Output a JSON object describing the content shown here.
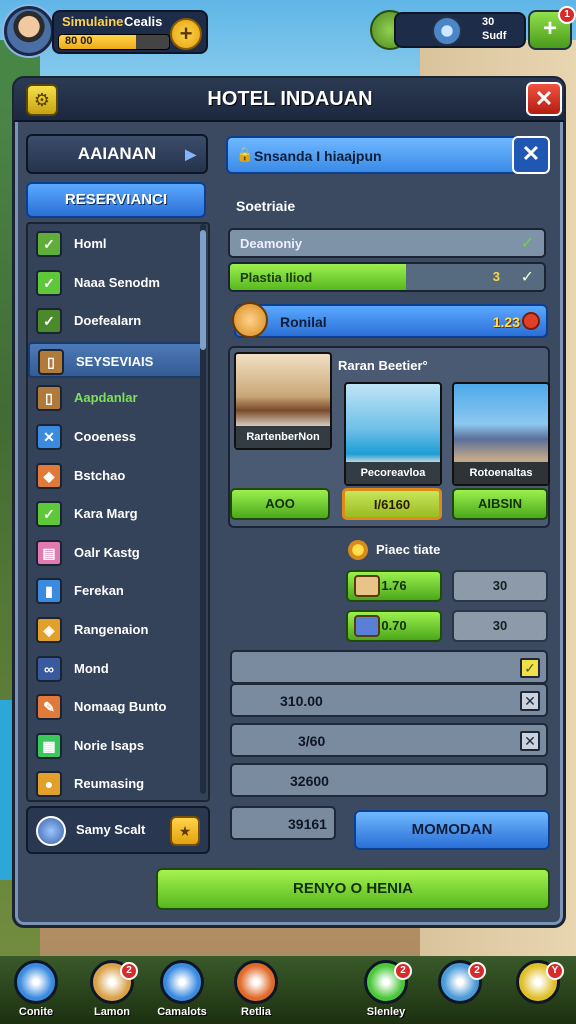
{
  "topbar": {
    "player_name": "Simulaine",
    "player_extra": "Cealis",
    "xp_text": "80 00",
    "xp_progress": 0.7,
    "resource_line1": "30",
    "resource_line2": "Sudf",
    "plus_label": "+",
    "shop_badge": "1"
  },
  "window": {
    "title": "HOTEL INDAUAN",
    "close_label": "✕"
  },
  "sidebar": {
    "category_header": "AAIANAN",
    "reservation_tab": "RESERVIANCI",
    "items": [
      {
        "label": "Homl",
        "icon": "check-icon",
        "color": "#5fae3a"
      },
      {
        "label": "Naaa Senodm",
        "icon": "check-icon",
        "color": "#5fc83a"
      },
      {
        "label": "Doefealarn",
        "icon": "check-icon",
        "color": "#4a8a2a"
      },
      {
        "label": "SEYSEVIAIS",
        "icon": "door-icon",
        "color": "#b07a3a"
      },
      {
        "label": "Aapdanlar",
        "icon": "door-icon",
        "color": "#b07a3a"
      },
      {
        "label": "Cooeness",
        "icon": "gear-icon",
        "color": "#3a8ae0"
      },
      {
        "label": "Bstchao",
        "icon": "bag-icon",
        "color": "#e07a3a"
      },
      {
        "label": "Kara Marg",
        "icon": "check-icon",
        "color": "#5fc83a"
      },
      {
        "label": "Oalr Kastg",
        "icon": "towel-icon",
        "color": "#e07ab0"
      },
      {
        "label": "Ferekan",
        "icon": "bucket-icon",
        "color": "#3a8ae0"
      },
      {
        "label": "Rangenaion",
        "icon": "warning-icon",
        "color": "#e0a02a"
      },
      {
        "label": "Mond",
        "icon": "glasses-icon",
        "color": "#3a5aa0"
      },
      {
        "label": "Nomaag Bunto",
        "icon": "tools-icon",
        "color": "#e07a3a"
      },
      {
        "label": "Norie Isaps",
        "icon": "book-icon",
        "color": "#3ac85a"
      },
      {
        "label": "Reumasing",
        "icon": "coin-icon",
        "color": "#e0a02a"
      }
    ],
    "user_label": "Samy Scalt"
  },
  "main": {
    "search_text": "Snsanda I hiaajpun",
    "section_label": "Soetriaie",
    "status_rows": [
      {
        "label": "Deamoniy",
        "check": "✓"
      },
      {
        "label": "Plastia Iliod",
        "score": "3",
        "check": "✓",
        "progress": 0.56
      }
    ],
    "coin_row": {
      "label": "Ronilal",
      "value": "1.23"
    },
    "gallery": {
      "title": "Raran Beetier°",
      "rooms": [
        {
          "caption": "RartenberNon",
          "button": "AOO"
        },
        {
          "caption": "Pecoreavloa",
          "button": "I/6160"
        },
        {
          "caption": "Rotoenaltas",
          "button": "AIBSIN"
        }
      ]
    },
    "facilities": {
      "label": "Piaec tiate",
      "rows": [
        {
          "value": "1.76",
          "other": "30"
        },
        {
          "value": "0.70",
          "other": "30"
        }
      ]
    },
    "fields": [
      {
        "value": "",
        "checked": true
      },
      {
        "value": "310.00",
        "checked": false
      },
      {
        "value": "3/60",
        "checked": false
      },
      {
        "value": "32600"
      },
      {
        "value": "39161"
      }
    ],
    "modify_button": "MOMODAN",
    "renew_button": "RENYO O HENIA"
  },
  "bottom_nav": [
    {
      "label": "Conite",
      "icon": "avatar-icon",
      "color": "#3a8ae0",
      "badge": ""
    },
    {
      "label": "Lamon",
      "icon": "box-icon",
      "color": "#d8a24a",
      "badge": "2"
    },
    {
      "label": "Camalots",
      "icon": "globe-icon",
      "color": "#3a8ae0",
      "badge": ""
    },
    {
      "label": "Retlia",
      "icon": "cross-icon",
      "color": "#e06a2a",
      "badge": ""
    },
    {
      "label": "Slenley",
      "icon": "phone-icon",
      "color": "#4ac83a",
      "badge": "2"
    },
    {
      "label": "",
      "icon": "map-icon",
      "color": "#4a9ad8",
      "badge": "2"
    },
    {
      "label": "",
      "icon": "settings-gear-icon",
      "color": "#e0c02a",
      "badge": "Y"
    }
  ]
}
